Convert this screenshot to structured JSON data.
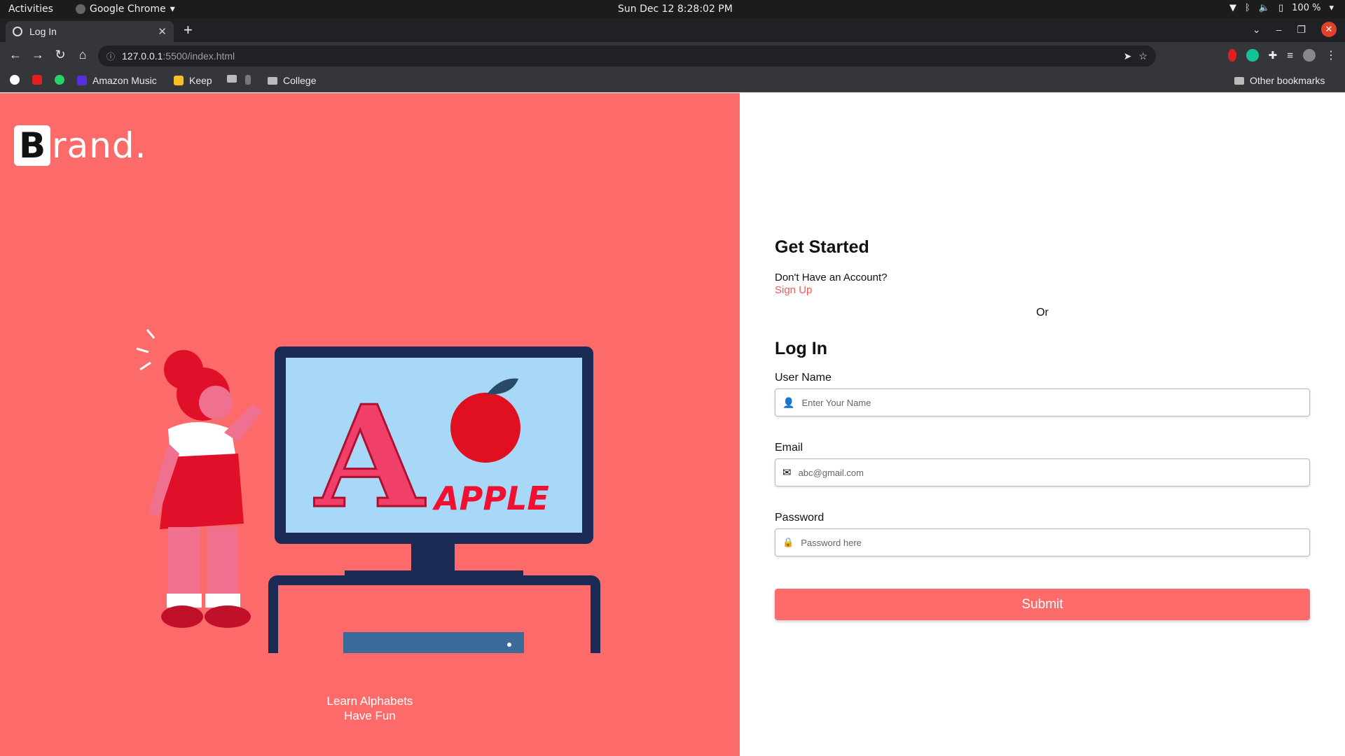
{
  "system_bar": {
    "activities": "Activities",
    "app_name": "Google Chrome",
    "clock": "Sun Dec 12  8:28:02 PM",
    "battery": "100 %"
  },
  "browser": {
    "tab_title": "Log In",
    "url_host": "127.0.0.1",
    "url_path": ":5500/index.html",
    "bookmarks": [
      "Amazon Music",
      "Keep",
      "College"
    ],
    "other_bookmarks": "Other bookmarks"
  },
  "left_panel": {
    "brand_initial": "B",
    "brand_rest": "rand.",
    "tagline_1": "Learn Alphabets",
    "tagline_2": "Have Fun",
    "illustration_letter": "A",
    "illustration_word": "APPLE"
  },
  "form": {
    "get_started": "Get Started",
    "no_account": "Don't Have an Account?",
    "sign_up": "Sign Up",
    "or": "Or",
    "log_in": "Log In",
    "username_label": "User Name",
    "username_placeholder": "Enter Your Name",
    "email_label": "Email",
    "email_placeholder": "abc@gmail.com",
    "password_label": "Password",
    "password_placeholder": "Password here",
    "submit": "Submit"
  },
  "colors": {
    "accent": "#fd6a6a",
    "link": "#f05a5a"
  }
}
